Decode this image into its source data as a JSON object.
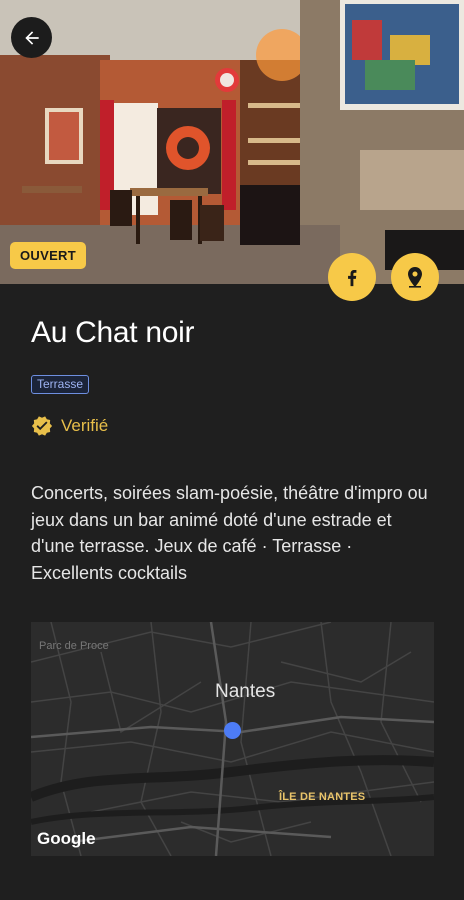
{
  "header": {
    "status_badge": "OUVERT",
    "back_icon": "arrow-left-icon",
    "actions": [
      {
        "name": "facebook",
        "icon": "facebook-icon"
      },
      {
        "name": "location",
        "icon": "map-pin-icon"
      }
    ]
  },
  "place": {
    "title": "Au Chat noir",
    "tag": "Terrasse",
    "verified_label": "Verifié",
    "description": "Concerts, soirées slam-poésie, théâtre d'impro ou jeux dans un bar animé doté d'une estrade et d'une terrasse.  Jeux de café · Terrasse · Excellents cocktails"
  },
  "map": {
    "city": "Nantes",
    "district": "ÎLE DE NANTES",
    "park": "Parc de Proce",
    "attribution": "Google"
  },
  "colors": {
    "background": "#1f1f1f",
    "accent": "#f7c948",
    "tag_border": "#6e8fe0",
    "pin": "#4d7cf5"
  }
}
